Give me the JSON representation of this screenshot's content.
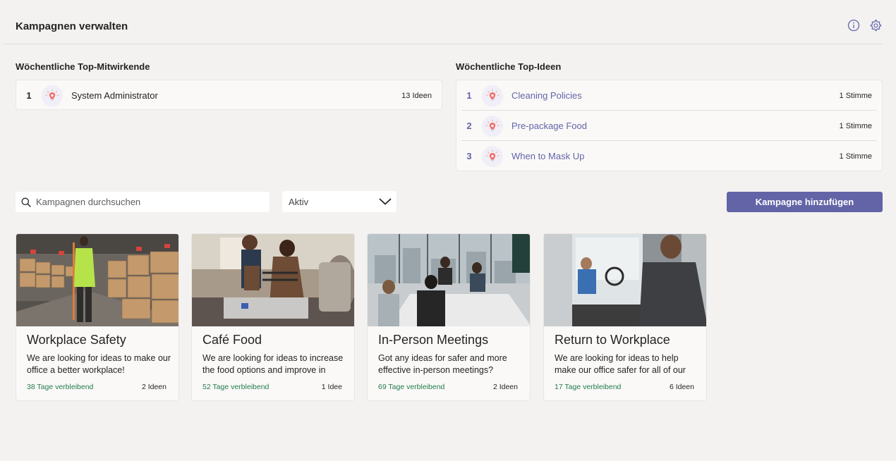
{
  "header": {
    "title": "Kampagnen verwalten",
    "icons": [
      "info-icon",
      "settings-icon"
    ]
  },
  "top_contributors": {
    "title": "Wöchentliche Top-Mitwirkende",
    "items": [
      {
        "rank": "1",
        "name": "System Administrator",
        "count": "13 Ideen"
      }
    ]
  },
  "top_ideas": {
    "title": "Wöchentliche Top-Ideen",
    "items": [
      {
        "rank": "1",
        "name": "Cleaning Policies",
        "count": "1 Stimme"
      },
      {
        "rank": "2",
        "name": "Pre-package Food",
        "count": "1 Stimme"
      },
      {
        "rank": "3",
        "name": "When to Mask Up",
        "count": "1 Stimme"
      }
    ]
  },
  "toolbar": {
    "search_placeholder": "Kampagnen durchsuchen",
    "filter_value": "Aktiv",
    "add_button": "Kampagne hinzufügen"
  },
  "campaigns": [
    {
      "title": "Workplace Safety",
      "description": "We are looking for ideas to make our office a better workplace!",
      "days": "38 Tage verbleibend",
      "ideas": "2 Ideen"
    },
    {
      "title": "Café Food",
      "description": "We are looking for ideas to increase the food options and improve in",
      "days": "52 Tage verbleibend",
      "ideas": "1 Idee"
    },
    {
      "title": "In-Person Meetings",
      "description": "Got any ideas for safer and more effective in-person meetings?",
      "days": "69 Tage verbleibend",
      "ideas": "2 Ideen"
    },
    {
      "title": "Return to Workplace",
      "description": "We are looking for ideas to help make our office safer for all of our",
      "days": "17 Tage verbleibend",
      "ideas": "6 Ideen"
    }
  ],
  "colors": {
    "accent": "#6264a7",
    "days_text": "#237b4b",
    "background": "#f3f2f1"
  }
}
